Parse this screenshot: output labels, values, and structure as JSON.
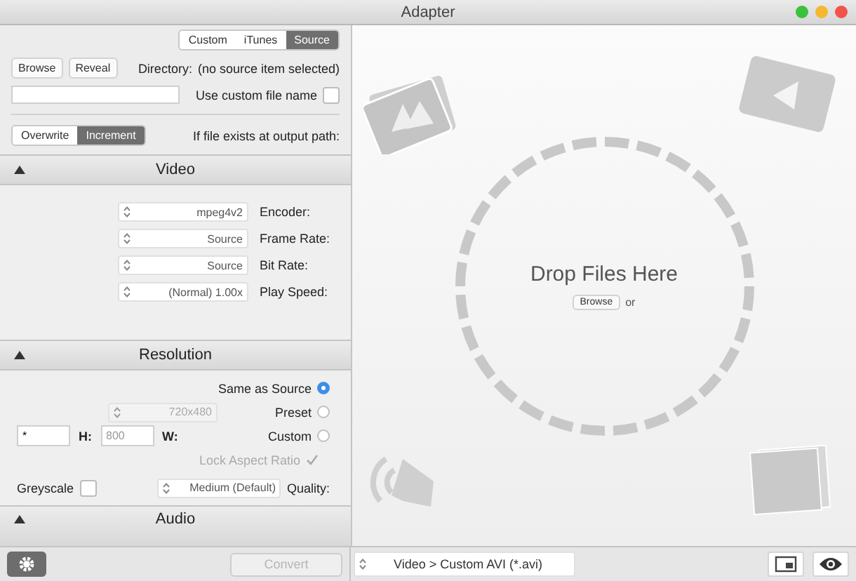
{
  "window": {
    "title": "Adapter"
  },
  "output_tabs": [
    {
      "label": "Custom",
      "selected": false
    },
    {
      "label": "iTunes",
      "selected": false
    },
    {
      "label": "Source",
      "selected": true
    }
  ],
  "directory": {
    "buttons": [
      "Browse",
      "Reveal"
    ],
    "label": "Directory:",
    "value": "(no source item selected)"
  },
  "custom_name": {
    "label": "Use custom file name",
    "checked": false
  },
  "if_exists": {
    "options": [
      {
        "label": "Overwrite",
        "selected": false
      },
      {
        "label": "Increment",
        "selected": true
      }
    ],
    "label": "If file exists at output path:"
  },
  "video": {
    "title": "Video",
    "expanded": true,
    "fields": [
      {
        "label": "Encoder:",
        "value": "mpeg4v2"
      },
      {
        "label": "Frame Rate:",
        "value": "Source"
      },
      {
        "label": "Bit Rate:",
        "value": "Source"
      },
      {
        "label": "Play Speed:",
        "value": "(Normal) 1.00x"
      }
    ]
  },
  "resolution": {
    "title": "Resolution",
    "expanded": true,
    "options": [
      {
        "label": "Same as Source",
        "selected": true
      },
      {
        "label": "Preset",
        "selected": false
      },
      {
        "label": "Custom",
        "selected": false
      }
    ],
    "preset_value": "720x480",
    "width_label": "W:",
    "width_value": "800",
    "height_label": "H:",
    "height_value": "*",
    "lock_aspect": {
      "label": "Lock Aspect Ratio",
      "checked": true,
      "disabled": true
    },
    "quality_label": "Quality:",
    "quality_value": "Medium (Default)",
    "greyscale": {
      "label": "Greyscale",
      "checked": false
    }
  },
  "audio": {
    "title": "Audio",
    "expanded": true
  },
  "convert_button": {
    "label": "Convert",
    "disabled": true
  },
  "drop_zone": {
    "title": "Drop Files Here",
    "or": "or",
    "browse": "Browse"
  },
  "output_format": "Video > Custom AVI (*.avi)"
}
